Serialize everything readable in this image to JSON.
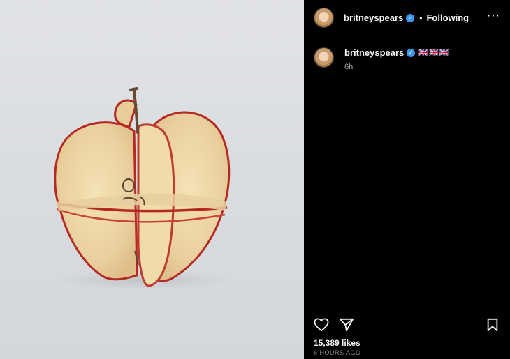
{
  "post": {
    "username": "britneyspears",
    "verified_symbol": "✓",
    "follow_status": "Following",
    "separator": "•",
    "more_symbol": "···",
    "caption_text": "🇬🇧🇬🇧🇬🇧",
    "relative_time": "6h",
    "likes_text": "15,389 likes",
    "posted_ago": "6 HOURS AGO"
  },
  "icons": {
    "avatar": "profile-photo",
    "like": "heart-icon",
    "share": "send-icon",
    "save": "bookmark-icon",
    "verified": "verified-badge-icon",
    "more": "more-options-icon"
  },
  "colors": {
    "panel_background": "#000000",
    "text_primary": "#f5f5f5",
    "text_secondary": "#a8a8a8",
    "verified_blue": "#3897f0",
    "apple_skin_red": "#b42a22",
    "apple_flesh": "#efd9a4"
  }
}
